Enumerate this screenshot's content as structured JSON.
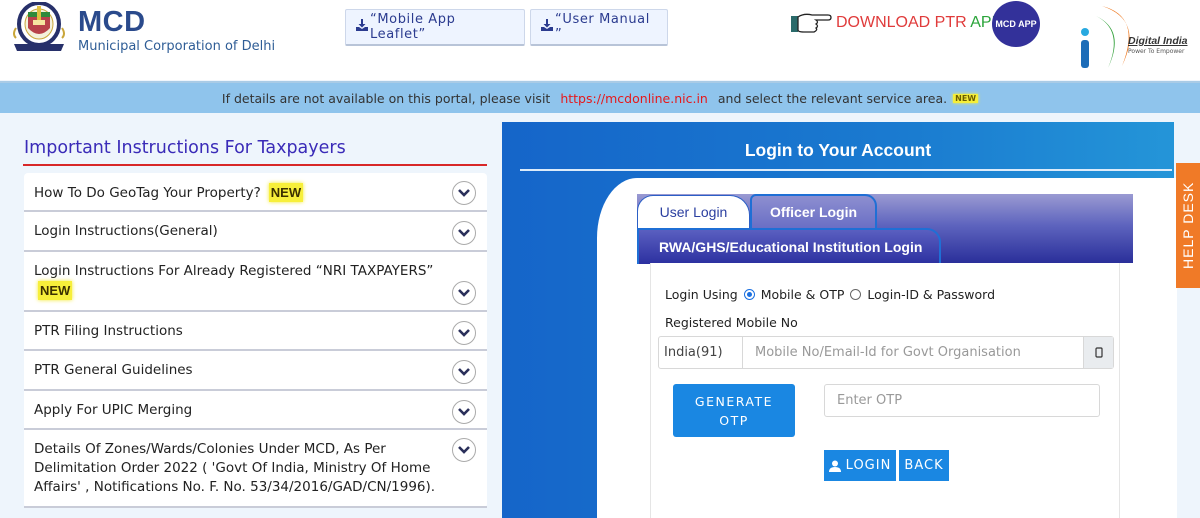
{
  "header": {
    "brand_title": "MCD",
    "brand_subtitle": "Municipal Corporation of Delhi",
    "buttons": [
      {
        "label": "“Mobile App Leaflet”",
        "icon": "download-icon"
      },
      {
        "label": "“User Manual ”",
        "icon": "download-icon"
      }
    ],
    "ptr_download": {
      "prefix": "DOWNLOAD PTR ",
      "suffix": "APP",
      "icon": "pointing-hand-icon"
    },
    "mcd_app_badge": "MCD APP",
    "digital_india": {
      "title": "Digital India",
      "tagline": "Power To Empower"
    }
  },
  "notice": {
    "text_before": "If details are not available on this portal, please visit",
    "link": "https://mcdonline.nic.in",
    "text_after": "and select the relevant service area.",
    "badge": "NEW"
  },
  "instructions": {
    "title": "Important Instructions For Taxpayers",
    "items": [
      {
        "label": "How To Do GeoTag Your Property?",
        "badge": "NEW"
      },
      {
        "label": "Login Instructions(General)",
        "badge": ""
      },
      {
        "label": "Login Instructions For Already Registered “NRI TAXPAYERS”",
        "badge": "NEW"
      },
      {
        "label": "PTR Filing Instructions",
        "badge": ""
      },
      {
        "label": "PTR General Guidelines",
        "badge": ""
      },
      {
        "label": "Apply For UPIC Merging",
        "badge": ""
      },
      {
        "label": "Details Of Zones/Wards/Colonies Under MCD, As Per Delimitation Order 2022 ( 'Govt Of India, Ministry Of Home Affairs' , Notifications No. F. No. 53/34/2016/GAD/CN/1996).",
        "badge": ""
      }
    ]
  },
  "login": {
    "title": "Login to Your Account",
    "tabs": {
      "user": "User Login",
      "officer": "Officer Login",
      "rwa": "RWA/GHS/Educational Institution Login"
    },
    "active_tab": "User Login",
    "login_using_label": "Login Using",
    "options": [
      "Mobile & OTP",
      "Login-ID & Password"
    ],
    "selected_option": "Mobile & OTP",
    "mobile_label": "Registered Mobile No",
    "country_code": "India(91)",
    "mobile_placeholder": "Mobile No/Email-Id for Govt Organisation",
    "mobile_value": "",
    "generate_otp_line1": "GENERATE",
    "generate_otp_line2": "OTP",
    "otp_placeholder": "Enter OTP",
    "otp_value": "",
    "login_button": "LOGIN",
    "back_button": "BACK"
  },
  "help_desk": "HELP DESK",
  "colors": {
    "brand_blue": "#2a4a8c",
    "login_panel": "#1a7bd0",
    "accent_button": "#1a87e2",
    "help_desk": "#f07a27",
    "notice_bg": "#8fc4ec",
    "instruction_title": "#3a2bb8",
    "link_red": "#e5191c"
  }
}
